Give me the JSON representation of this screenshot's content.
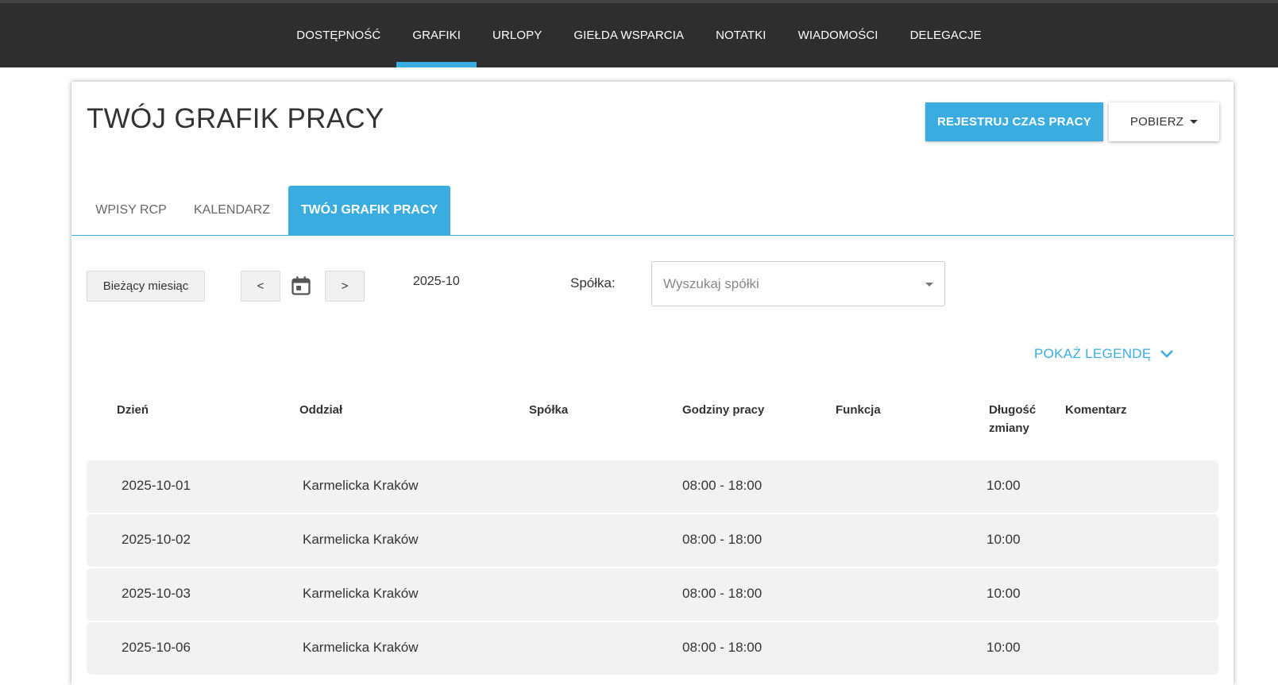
{
  "nav": {
    "items": [
      {
        "label": "DOSTĘPNOŚĆ",
        "active": false
      },
      {
        "label": "GRAFIKI",
        "active": true
      },
      {
        "label": "URLOPY",
        "active": false
      },
      {
        "label": "GIEŁDA WSPARCIA",
        "active": false
      },
      {
        "label": "NOTATKI",
        "active": false
      },
      {
        "label": "WIADOMOŚCI",
        "active": false
      },
      {
        "label": "DELEGACJE",
        "active": false
      }
    ]
  },
  "header": {
    "title": "TWÓJ GRAFIK PRACY",
    "register_label": "REJESTRUJ CZAS PRACY",
    "download_label": "POBIERZ"
  },
  "tabs": [
    {
      "label": "WPISY RCP",
      "active": false
    },
    {
      "label": "KALENDARZ",
      "active": false
    },
    {
      "label": "TWÓJ GRAFIK PRACY",
      "active": true
    }
  ],
  "filters": {
    "current_month_label": "Bieżący miesiąc",
    "prev_label": "<",
    "next_label": ">",
    "period": "2025-10",
    "company_label": "Spółka:",
    "company_placeholder": "Wyszukaj spółki"
  },
  "legend": {
    "toggle_label": "POKAŻ LEGENDĘ"
  },
  "table": {
    "headers": {
      "day": "Dzień",
      "branch": "Oddział",
      "company": "Spółka",
      "hours": "Godziny pracy",
      "function": "Funkcja",
      "length_line1": "Długość",
      "length_line2": "zmiany",
      "comment": "Komentarz"
    },
    "rows": [
      {
        "day": "2025-10-01",
        "branch": "Karmelicka Kraków",
        "company": "",
        "hours": "08:00 - 18:00",
        "function": "",
        "length": "10:00",
        "comment": ""
      },
      {
        "day": "2025-10-02",
        "branch": "Karmelicka Kraków",
        "company": "",
        "hours": "08:00 - 18:00",
        "function": "",
        "length": "10:00",
        "comment": ""
      },
      {
        "day": "2025-10-03",
        "branch": "Karmelicka Kraków",
        "company": "",
        "hours": "08:00 - 18:00",
        "function": "",
        "length": "10:00",
        "comment": ""
      },
      {
        "day": "2025-10-06",
        "branch": "Karmelicka Kraków",
        "company": "",
        "hours": "08:00 - 18:00",
        "function": "",
        "length": "10:00",
        "comment": ""
      }
    ]
  },
  "colors": {
    "accent": "#3aace0",
    "topbar": "#2e2e2e"
  },
  "icons": {
    "calendar": "calendar-icon",
    "legend": "chevron-down-icon",
    "download": "caret-down-icon"
  }
}
